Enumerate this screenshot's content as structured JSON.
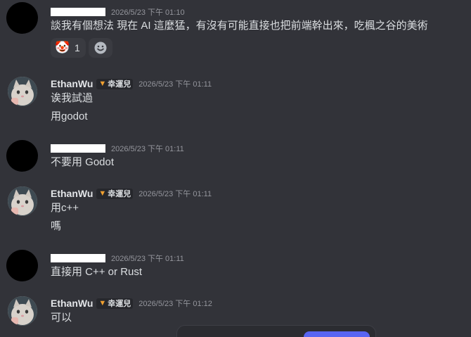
{
  "messages": [
    {
      "author": "",
      "author_redacted": true,
      "timestamp": "2026/5/23 下午 01:10",
      "lines": [
        "談我有個想法 現在 AI 這麼猛，有沒有可能直接也把前端幹出來，吃楓之谷的美術"
      ],
      "reactions": [
        {
          "emoji": "clown-face",
          "glyph": "🤡",
          "count": "1"
        }
      ]
    },
    {
      "author": "EthanWu",
      "tag": "幸運兒",
      "tag_icon": "fox-icon",
      "timestamp": "2026/5/23 下午 01:11",
      "lines": [
        "诶我試過",
        "用godot"
      ]
    },
    {
      "author": "",
      "author_redacted": true,
      "timestamp": "2026/5/23 下午 01:11",
      "lines": [
        "不要用 Godot"
      ]
    },
    {
      "author": "EthanWu",
      "tag": "幸運兒",
      "tag_icon": "fox-icon",
      "timestamp": "2026/5/23 下午 01:11",
      "lines": [
        "用c++",
        "嗎"
      ]
    },
    {
      "author": "",
      "author_redacted": true,
      "timestamp": "2026/5/23 下午 01:11",
      "lines": [
        "直接用 C++ or Rust"
      ]
    },
    {
      "author": "EthanWu",
      "tag": "幸運兒",
      "tag_icon": "fox-icon",
      "timestamp": "2026/5/23 下午 01:12",
      "lines": [
        "可以"
      ]
    }
  ],
  "colors": {
    "background": "#323339",
    "text": "#dbdee1",
    "timestamp": "#94959c",
    "accent": "#5865f2"
  }
}
